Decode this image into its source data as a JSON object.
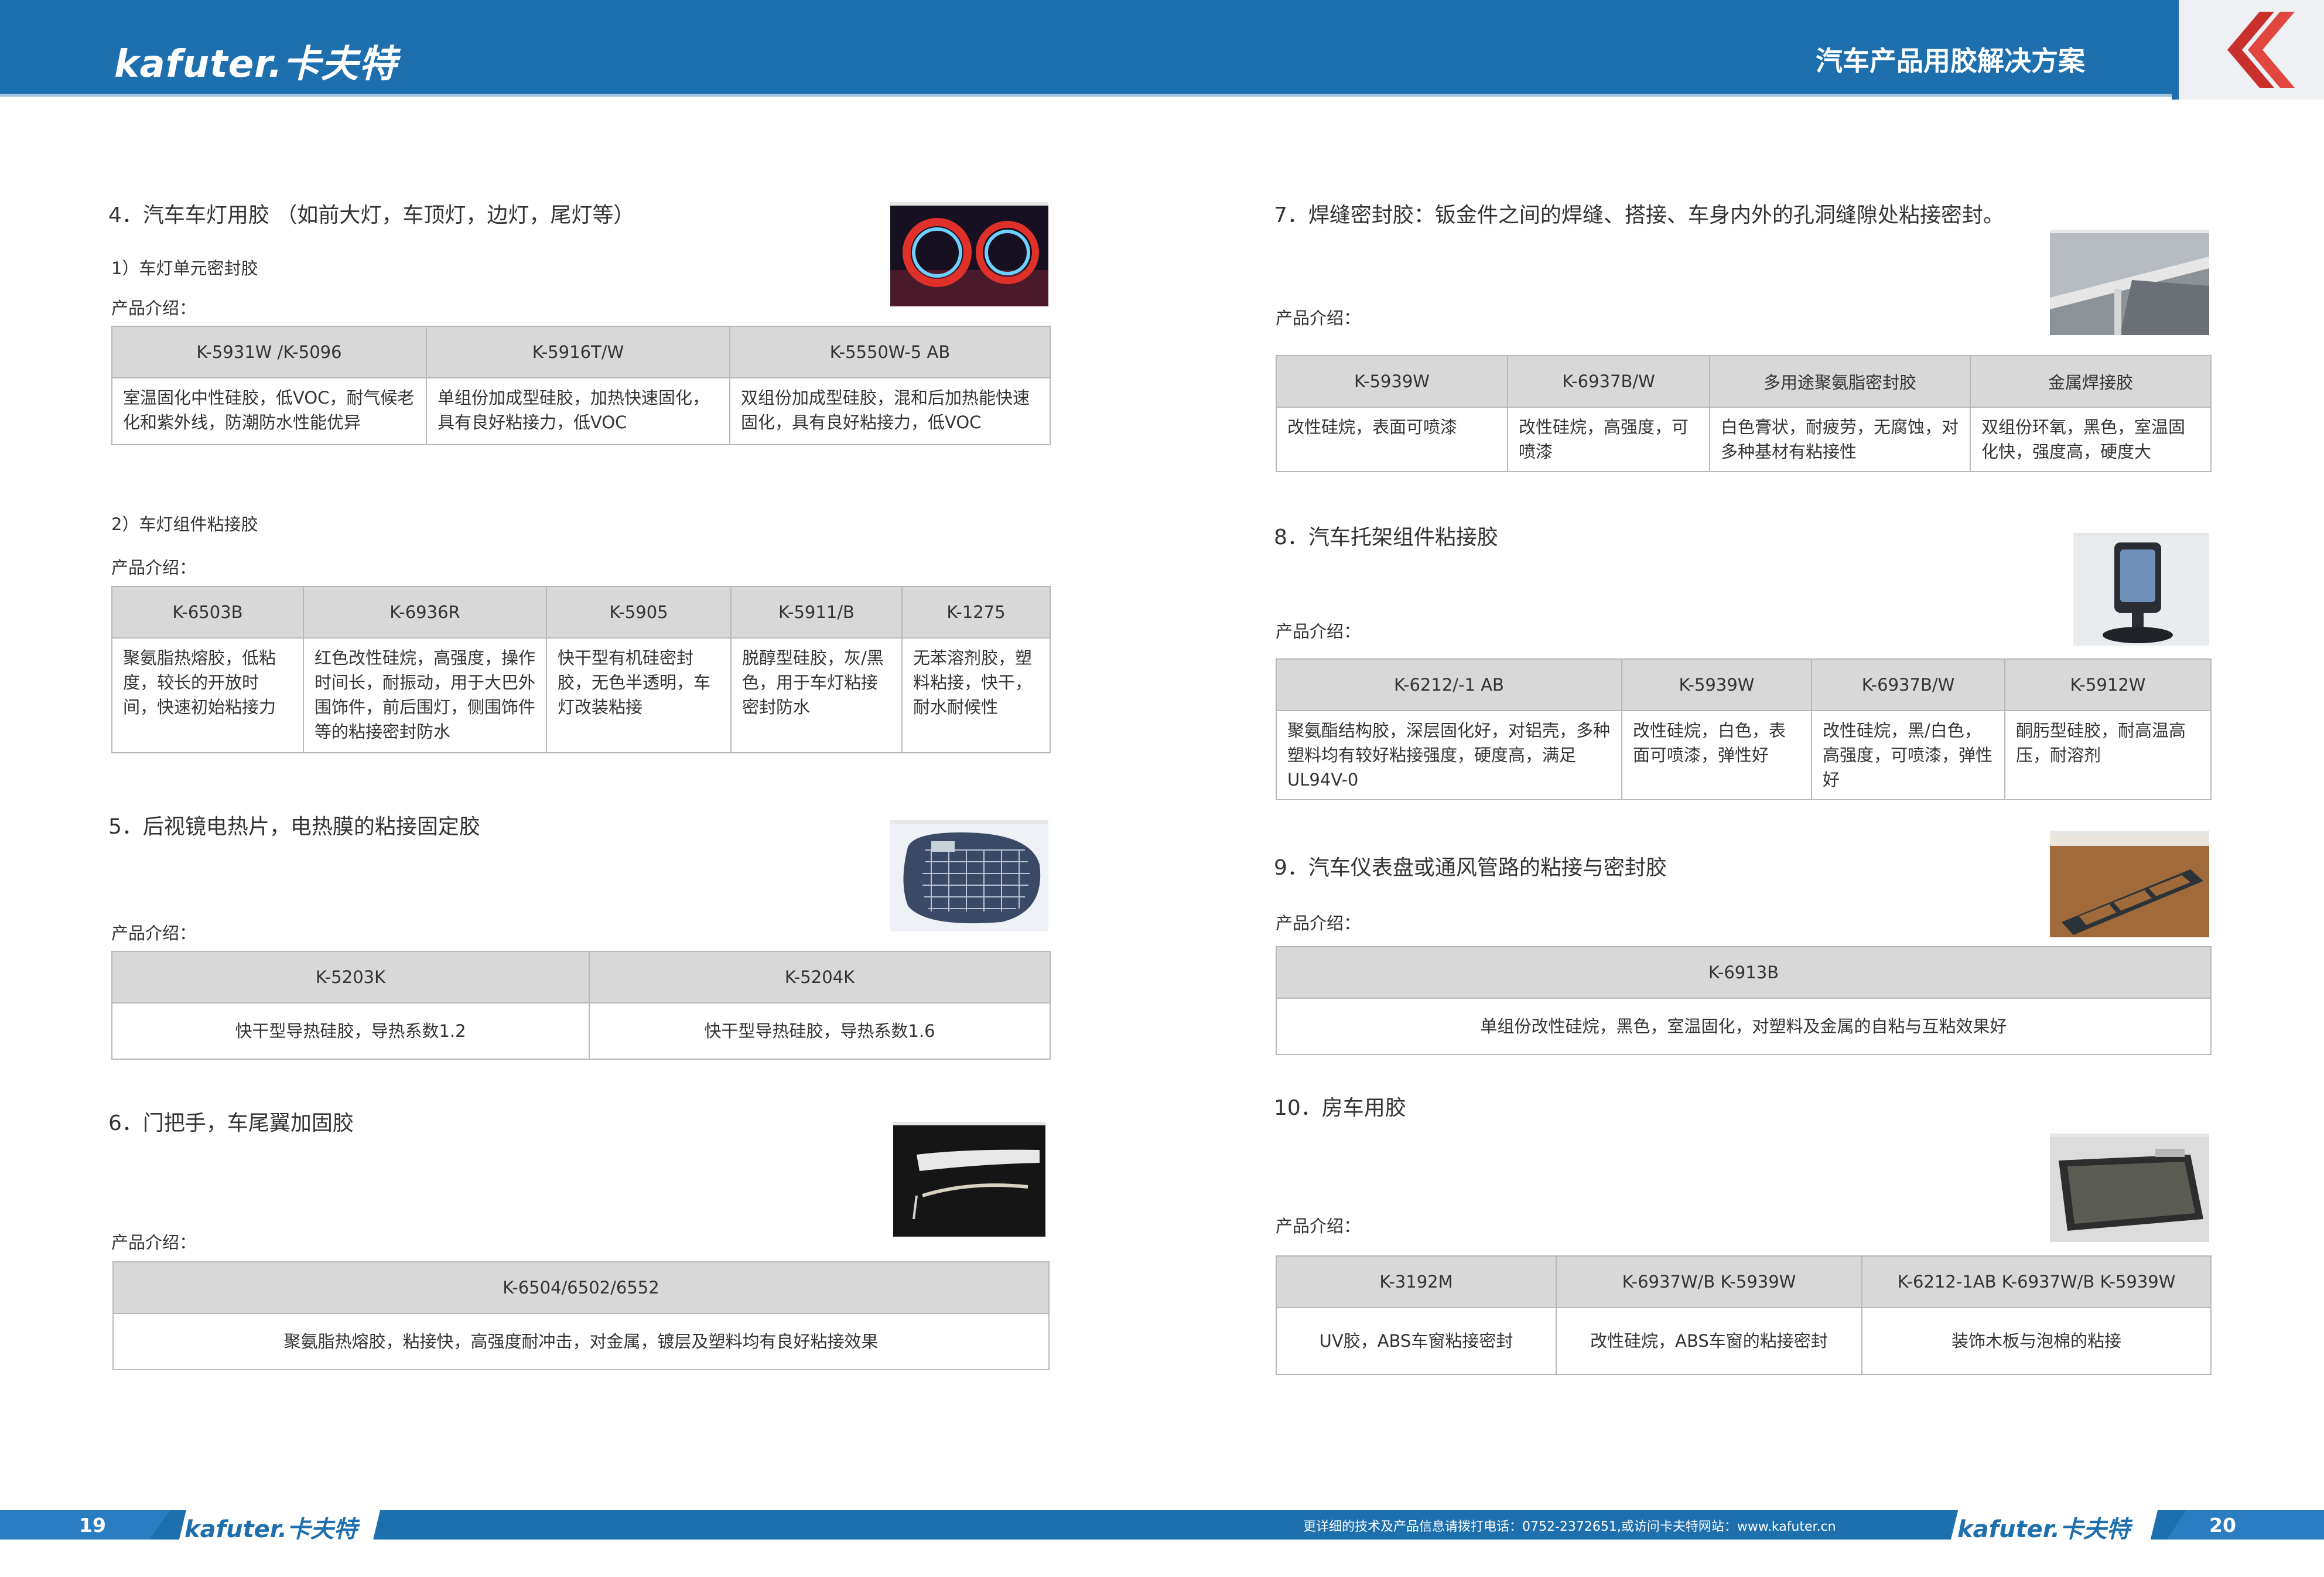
{
  "header": {
    "brand": "kafuter.卡夫特",
    "title": "汽车产品用胶解决方案"
  },
  "left": {
    "s4": {
      "title": "4．汽车车灯用胶 （如前大灯，车顶灯，边灯，尾灯等）",
      "sub1": "1）车灯单元密封胶",
      "intro1": "产品介绍：",
      "t1": {
        "headers": [
          "K-5931W /K-5096",
          "K-5916T/W",
          "K-5550W-5 AB"
        ],
        "cells": [
          "室温固化中性硅胶，低VOC，耐气候老化和紫外线，防潮防水性能优异",
          "单组份加成型硅胶，加热快速固化，具有良好粘接力，低VOC",
          "双组份加成型硅胶，混和后加热能快速固化，具有良好粘接力，低VOC"
        ]
      },
      "sub2": "2）车灯组件粘接胶",
      "intro2": "产品介绍：",
      "t2": {
        "headers": [
          "K-6503B",
          "K-6936R",
          "K-5905",
          "K-5911/B",
          "K-1275"
        ],
        "cells": [
          "聚氨脂热熔胶，低粘度，较长的开放时间，快速初始粘接力",
          "红色改性硅烷，高强度，操作时间长，耐振动，用于大巴外围饰件，前后围灯，侧围饰件等的粘接密封防水",
          "快干型有机硅密封胶，无色半透明，车灯改装粘接",
          "脱醇型硅胶，灰/黑色，用于车灯粘接密封防水",
          "无苯溶剂胶，塑料粘接，快干，耐水耐候性"
        ]
      }
    },
    "s5": {
      "title": "5．后视镜电热片，电热膜的粘接固定胶",
      "intro": "产品介绍：",
      "t": {
        "headers": [
          "K-5203K",
          "K-5204K"
        ],
        "cells": [
          "快干型导热硅胶，导热系数1.2",
          "快干型导热硅胶，导热系数1.6"
        ]
      }
    },
    "s6": {
      "title": "6．门把手，车尾翼加固胶",
      "intro": "产品介绍：",
      "t": {
        "headers": [
          "K-6504/6502/6552"
        ],
        "cells": [
          "聚氨脂热熔胶，粘接快，高强度耐冲击，对金属，镀层及塑料均有良好粘接效果"
        ]
      }
    }
  },
  "right": {
    "s7": {
      "title": "7．焊缝密封胶：钣金件之间的焊缝、搭接、车身内外的孔洞缝隙处粘接密封。",
      "intro": "产品介绍：",
      "t": {
        "headers": [
          "K-5939W",
          "K-6937B/W",
          "多用途聚氨脂密封胶",
          "金属焊接胶"
        ],
        "cells": [
          "改性硅烷，表面可喷漆",
          "改性硅烷，高强度，可喷漆",
          "白色膏状，耐疲劳，无腐蚀，对多种基材有粘接性",
          "双组份环氧，黑色，室温固化快，强度高，硬度大"
        ]
      }
    },
    "s8": {
      "title": "8．汽车托架组件粘接胶",
      "intro": "产品介绍：",
      "t": {
        "headers": [
          "K-6212/-1 AB",
          "K-5939W",
          "K-6937B/W",
          "K-5912W"
        ],
        "cells": [
          "聚氨酯结构胶，深层固化好，对铝壳，多种塑料均有较好粘接强度，硬度高，满足UL94V-0",
          "改性硅烷，白色，表面可喷漆，弹性好",
          "改性硅烷，黑/白色，高强度，可喷漆，弹性好",
          "酮肟型硅胶，耐高温高压，耐溶剂"
        ]
      }
    },
    "s9": {
      "title": "9．汽车仪表盘或通风管路的粘接与密封胶",
      "intro": "产品介绍：",
      "t": {
        "headers": [
          "K-6913B"
        ],
        "cells": [
          "单组份改性硅烷，黑色，室温固化，对塑料及金属的自粘与互粘效果好"
        ]
      }
    },
    "s10": {
      "title": "10．房车用胶",
      "intro": "产品介绍：",
      "t": {
        "headers": [
          "K-3192M",
          "K-6937W/B K-5939W",
          "K-6212-1AB K-6937W/B K-5939W"
        ],
        "cells": [
          "UV胶，ABS车窗粘接密封",
          "改性硅烷，ABS车窗的粘接密封",
          "装饰木板与泡棉的粘接"
        ]
      }
    }
  },
  "footer": {
    "page_left": "19",
    "page_right": "20",
    "brand": "kafuter.卡夫特",
    "contact": "更详细的技术及产品信息请拨打电话：0752-2372651,或访问卡夫特网站：www.kafuter.cn"
  }
}
